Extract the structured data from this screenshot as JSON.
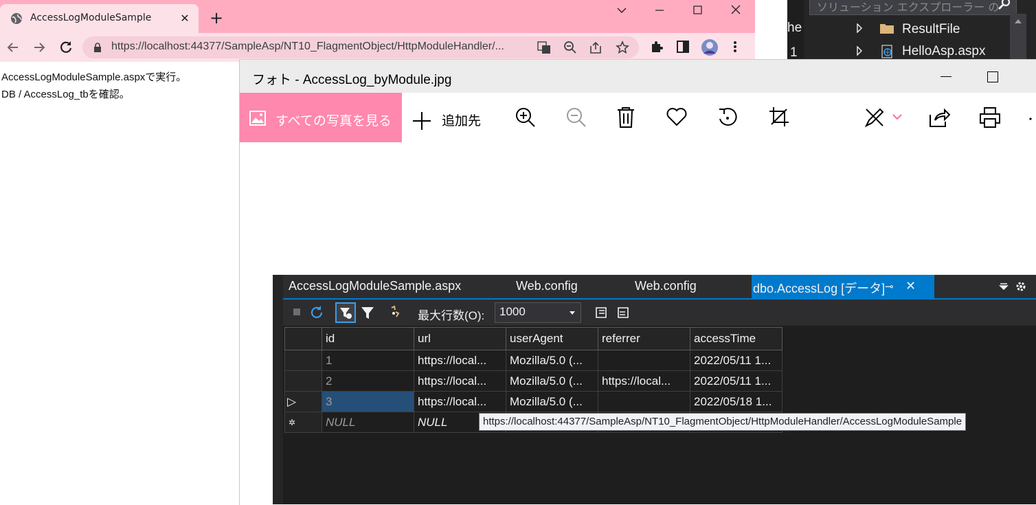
{
  "browser": {
    "tab_title": "AccessLogModuleSample",
    "tab_close": "✕",
    "new_tab": "+",
    "url": "https://localhost:44377/SampleAsp/NT10_FlagmentObject/HttpModuleHandler/...",
    "page_lines": [
      "AccessLogModuleSample.aspxで実行。",
      "DB / AccessLog_tbを確認。"
    ]
  },
  "solution_explorer": {
    "search_placeholder": "ソリューション エクスプローラー の",
    "items": [
      {
        "label": "ResultFile",
        "icon": "folder-icon"
      },
      {
        "label": "HelloAsp.aspx",
        "icon": "web-file-icon"
      }
    ],
    "left_fragments": [
      "he",
      "1"
    ]
  },
  "photos": {
    "title": "フォト - AccessLog_byModule.jpg",
    "see_all_label": "すべての写真を見る",
    "add_to_label": "追加先",
    "commands": [
      "zoom-in-icon",
      "zoom-out-icon",
      "delete-icon",
      "favorite-icon",
      "rotate-icon",
      "crop-icon",
      "edit-icon",
      "share-icon",
      "print-icon",
      "more-icon"
    ],
    "accent_color": "#ff88ae"
  },
  "image": {
    "doc_tabs": [
      "AccessLogModuleSample.aspx",
      "Web.config",
      "Web.config",
      "dbo.AccessLog [データ]"
    ],
    "active_tab_pin": "⊸",
    "active_tab_close": "✕",
    "max_rows_label": "最大行数(O):",
    "max_rows_value": "1000",
    "columns": [
      "id",
      "url",
      "userAgent",
      "referrer",
      "accessTime"
    ],
    "rows": [
      {
        "marker": "",
        "id": "1",
        "url": "https://local...",
        "userAgent": "Mozilla/5.0 (...",
        "referrer": "",
        "accessTime": "2022/05/11 1..."
      },
      {
        "marker": "",
        "id": "2",
        "url": "https://local...",
        "userAgent": "Mozilla/5.0 (...",
        "referrer": "https://local...",
        "accessTime": "2022/05/11 1..."
      },
      {
        "marker": "▷",
        "id": "3",
        "url": "https://local...",
        "userAgent": "Mozilla/5.0 (...",
        "referrer": "",
        "accessTime": "2022/05/18 1..."
      },
      {
        "marker": "✲",
        "id": "NULL",
        "url": "NULL",
        "userAgent": "",
        "referrer": "",
        "accessTime": ""
      }
    ],
    "tooltip": "https://localhost:44377/SampleAsp/NT10_FlagmentObject/HttpModuleHandler/AccessLogModuleSample"
  }
}
